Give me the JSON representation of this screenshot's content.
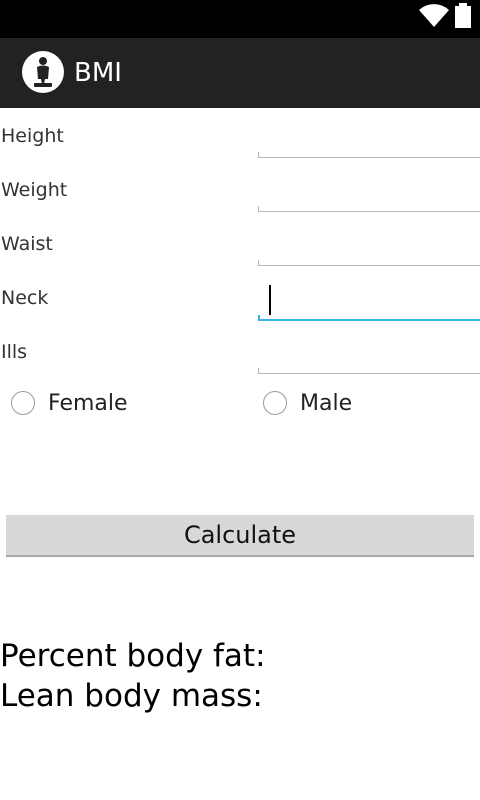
{
  "status_bar": {
    "icons": [
      "wifi-icon",
      "battery-icon"
    ]
  },
  "action_bar": {
    "app_icon": "person-scale-icon",
    "title": "BMI"
  },
  "form": {
    "fields": [
      {
        "label": "Height",
        "value": "",
        "focused": false
      },
      {
        "label": "Weight",
        "value": "",
        "focused": false
      },
      {
        "label": "Waist",
        "value": "",
        "focused": false
      },
      {
        "label": "Neck",
        "value": "",
        "focused": true
      },
      {
        "label": "Ills",
        "value": "",
        "focused": false
      }
    ],
    "gender": {
      "female_label": "Female",
      "male_label": "Male",
      "selected": ""
    }
  },
  "calculate_label": "Calculate",
  "results": {
    "body_fat_label": "Percent body fat:",
    "lean_mass_label": "Lean body mass:"
  },
  "colors": {
    "status_bar": "#000000",
    "action_bar": "#222222",
    "focus_accent": "#33b5e5",
    "button_bg": "#d8d8d8"
  }
}
